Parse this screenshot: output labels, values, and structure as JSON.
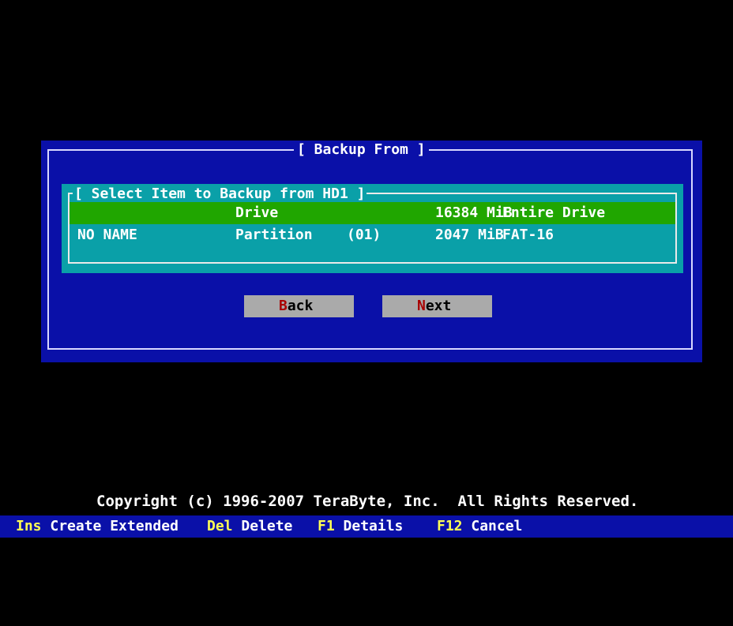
{
  "dialog": {
    "title": "[ Backup From ]",
    "panel": {
      "title": "[ Select Item to Backup from HD1 ]",
      "rows": [
        {
          "name": "",
          "type": "Drive",
          "number": "",
          "size": "16384 MiB",
          "description": "Entire Drive",
          "selected": true
        },
        {
          "name": "NO NAME",
          "type": "Partition",
          "number": "(01)",
          "size": "2047 MiB",
          "description": "FAT-16",
          "selected": false
        }
      ]
    },
    "buttons": {
      "back": {
        "hotkey": "B",
        "rest": "ack"
      },
      "next": {
        "hotkey": "N",
        "rest": "ext"
      }
    }
  },
  "copyright": "Copyright (c) 1996-2007 TeraByte, Inc.  All Rights Reserved.",
  "statusbar": [
    {
      "key": "Ins",
      "label": "Create Extended"
    },
    {
      "key": "Del",
      "label": "Delete"
    },
    {
      "key": "F1",
      "label": "Details"
    },
    {
      "key": "F12",
      "label": "Cancel"
    }
  ],
  "colors": {
    "background": "#000000",
    "dialog": "#0a10a8",
    "panel": "#0aa0a8",
    "selected_row": "#20a600",
    "button": "#aaaaaa",
    "hotkey_letter": "#a80000",
    "statusbar_key": "#ffff55"
  }
}
